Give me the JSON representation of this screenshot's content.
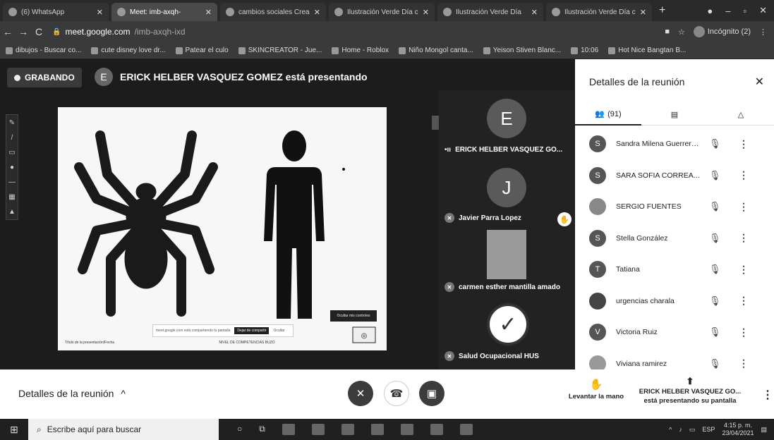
{
  "browser": {
    "tabs": [
      {
        "title": "(6) WhatsApp",
        "active": false
      },
      {
        "title": "Meet: imb-axqh-",
        "active": true
      },
      {
        "title": "cambios sociales Crea",
        "active": false
      },
      {
        "title": "Ilustración Verde Día c",
        "active": false
      },
      {
        "title": "Ilustración Verde Día",
        "active": false
      },
      {
        "title": "Ilustración Verde Día c",
        "active": false
      }
    ],
    "new_tab": "+",
    "url_host": "meet.google.com",
    "url_path": "/imb-axqh-ixd",
    "incognito_label": "Incógnito (2)",
    "bookmarks": [
      "dibujos - Buscar co...",
      "cute disney love dr...",
      "Patear el culo",
      "SKINCREATOR - Jue...",
      "Home - Roblox",
      "Niño Mongol canta...",
      "Yeison Stiven Blanc...",
      "10:06",
      "Hot Nice Bangtan B..."
    ]
  },
  "meeting": {
    "recording_label": "GRABANDO",
    "presenter_initial": "E",
    "presenter_text": "ERICK HELBER VASQUEZ GOMEZ está presentando",
    "slide": {
      "footer_left": "Título de la presentación/Fecha",
      "footer_center": "NIVEL DE COMPETENCIAS BUZO",
      "share_text": "meet.google.com está compartiendo tu pantalla",
      "stop_share": "Dejar de compartir",
      "hide": "Ocultar",
      "right_button": "Ocultar mis controles"
    },
    "tiles": [
      {
        "initial": "E",
        "name": "ERICK HELBER VASQUEZ GO...",
        "kind": "avatar"
      },
      {
        "initial": "J",
        "name": "Javier Parra Lopez",
        "kind": "avatar"
      },
      {
        "initial": "",
        "name": "carmen esther mantilla amado",
        "kind": "photo"
      },
      {
        "initial": "",
        "name": "Salud Ocupacional HUS",
        "kind": "logo"
      }
    ]
  },
  "panel": {
    "title": "Detalles de la reunión",
    "people_count": "(91)",
    "participants": [
      {
        "initial": "S",
        "name": "Sandra Milena Guerrero..."
      },
      {
        "initial": "S",
        "name": "SARA SOFIA CORREA C..."
      },
      {
        "initial": "",
        "name": "SERGIO FUENTES"
      },
      {
        "initial": "S",
        "name": "Stella González"
      },
      {
        "initial": "T",
        "name": "Tatiana"
      },
      {
        "initial": "",
        "name": "urgencias charala"
      },
      {
        "initial": "V",
        "name": "Victoria Ruiz"
      },
      {
        "initial": "",
        "name": "Viviana ramirez"
      }
    ]
  },
  "bottom": {
    "details_label": "Detalles de la reunión",
    "raise_hand": "Levantar la mano",
    "presenting_name": "ERICK HELBER VASQUEZ GO...",
    "presenting_sub": "está presentando su pantalla"
  },
  "taskbar": {
    "search_placeholder": "Escribe aquí para buscar",
    "lang": "ESP",
    "time": "4:15 p. m.",
    "date": "23/04/2021"
  }
}
